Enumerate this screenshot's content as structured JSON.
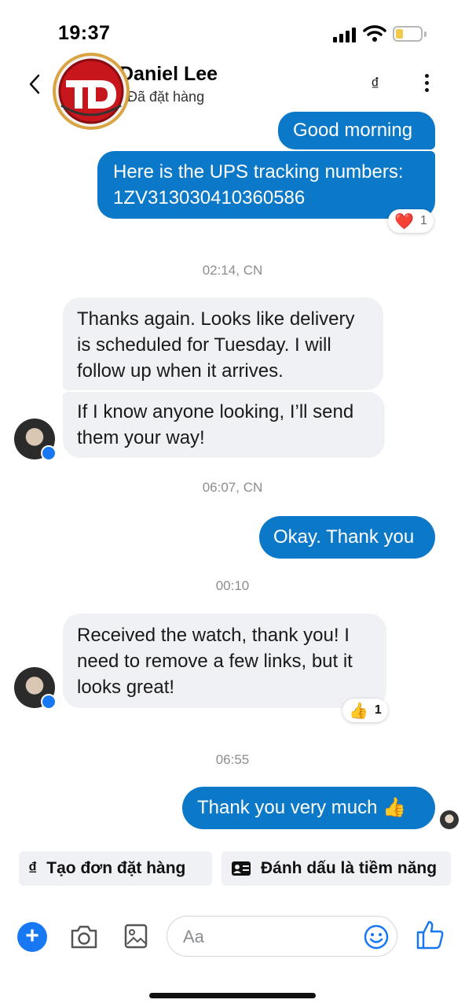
{
  "status_bar": {
    "time": "19:37",
    "battery_level": 0.3
  },
  "header": {
    "contact_name": "Daniel Lee",
    "contact_status": "Đã đặt hàng",
    "currency_symbol": "₫"
  },
  "messages": {
    "out1": "Good morning",
    "out2_line1": "Here is the UPS tracking numbers:",
    "out2_line2": "1ZV313030410360586",
    "out2_reaction": {
      "emoji": "❤️",
      "count": "1"
    },
    "ts1": "02:14, CN",
    "in1_line1": "Thanks again. Looks like delivery",
    "in1_line2": "is scheduled for Tuesday. I will",
    "in1_line3": "follow up when it arrives.",
    "in2_line1": "If I know anyone looking, I’ll send",
    "in2_line2": "them your way!",
    "ts2": "06:07, CN",
    "out3": "Okay. Thank you",
    "ts3": "00:10",
    "in3_line1": "Received the watch, thank you! I",
    "in3_line2": "need to remove a few links, but it",
    "in3_line3": "looks great!",
    "in3_reaction": {
      "emoji": "👍",
      "count": "1"
    },
    "ts4": "06:55",
    "out4": "Thank you very much 👍"
  },
  "quick_actions": {
    "create_order_icon": "₫",
    "create_order": "Tạo đơn đặt hàng",
    "mark_potential": "Đánh dấu là tiềm năng"
  },
  "composer": {
    "placeholder": "Aa"
  },
  "colors": {
    "outgoing_bubble": "#0c78c8",
    "incoming_bubble": "#f0f1f4",
    "accent": "#1877f2"
  }
}
